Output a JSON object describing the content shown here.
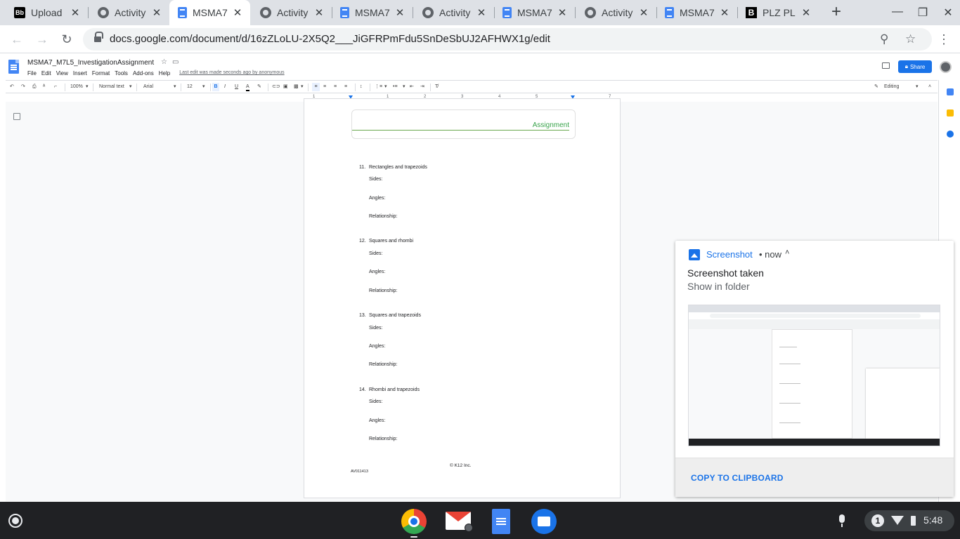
{
  "browser": {
    "tabs": [
      {
        "title": "Upload",
        "favicon": "blackboard-icon",
        "favicon_text": "Bb"
      },
      {
        "title": "Activity",
        "favicon": "globe-icon"
      },
      {
        "title": "MSMA7",
        "favicon": "docs-icon",
        "active": true
      },
      {
        "title": "Activity",
        "favicon": "globe-icon"
      },
      {
        "title": "MSMA7",
        "favicon": "docs-icon"
      },
      {
        "title": "Activity",
        "favicon": "globe-icon"
      },
      {
        "title": "MSMA7",
        "favicon": "docs-icon"
      },
      {
        "title": "Activity",
        "favicon": "globe-icon"
      },
      {
        "title": "MSMA7",
        "favicon": "docs-icon"
      },
      {
        "title": "PLZ PL",
        "favicon": "brainly-icon",
        "favicon_text": "B"
      }
    ],
    "close_glyph": "✕",
    "new_tab_glyph": "+",
    "url": "docs.google.com/document/d/16zZLoLU-2X5Q2___JiGFRPmFdu5SnDeSbUJ2AFHWX1g/edit"
  },
  "docs": {
    "title": "MSMA7_M7L5_InvestigationAssignment",
    "menus": [
      "File",
      "Edit",
      "View",
      "Insert",
      "Format",
      "Tools",
      "Add-ons",
      "Help"
    ],
    "last_edit": "Last edit was made seconds ago by anonymous",
    "share_label": "Share",
    "toolbar": {
      "zoom": "100%",
      "style": "Normal text",
      "font": "Arial",
      "size": "12",
      "bold": "B",
      "italic": "I",
      "underline": "U",
      "text_color": "A",
      "mode": "Editing"
    },
    "ruler_numbers": [
      "1",
      "1",
      "2",
      "3",
      "4",
      "5",
      "6",
      "7"
    ]
  },
  "document": {
    "header_label": "Assignment",
    "questions": [
      {
        "number": "11.",
        "title": "Rectangles and trapezoids"
      },
      {
        "number": "12.",
        "title": "Squares and rhombi"
      },
      {
        "number": "13.",
        "title": "Squares and trapezoids"
      },
      {
        "number": "14.",
        "title": "Rhombi and trapezoids"
      }
    ],
    "fields": {
      "sides": "Sides:",
      "angles": "Angles:",
      "relationship": "Relationship:"
    },
    "copyright": "© K12 Inc.",
    "code": "AV011413"
  },
  "notification": {
    "app_name": "Screenshot",
    "time": "• now",
    "title": "Screenshot taken",
    "message": "Show in folder",
    "action": "COPY TO CLIPBOARD"
  },
  "shelf": {
    "tray_badge": "1",
    "time": "5:48"
  },
  "colors": {
    "accent": "#1a73e8",
    "header_green": "#38a34a",
    "shelf": "#202124"
  }
}
